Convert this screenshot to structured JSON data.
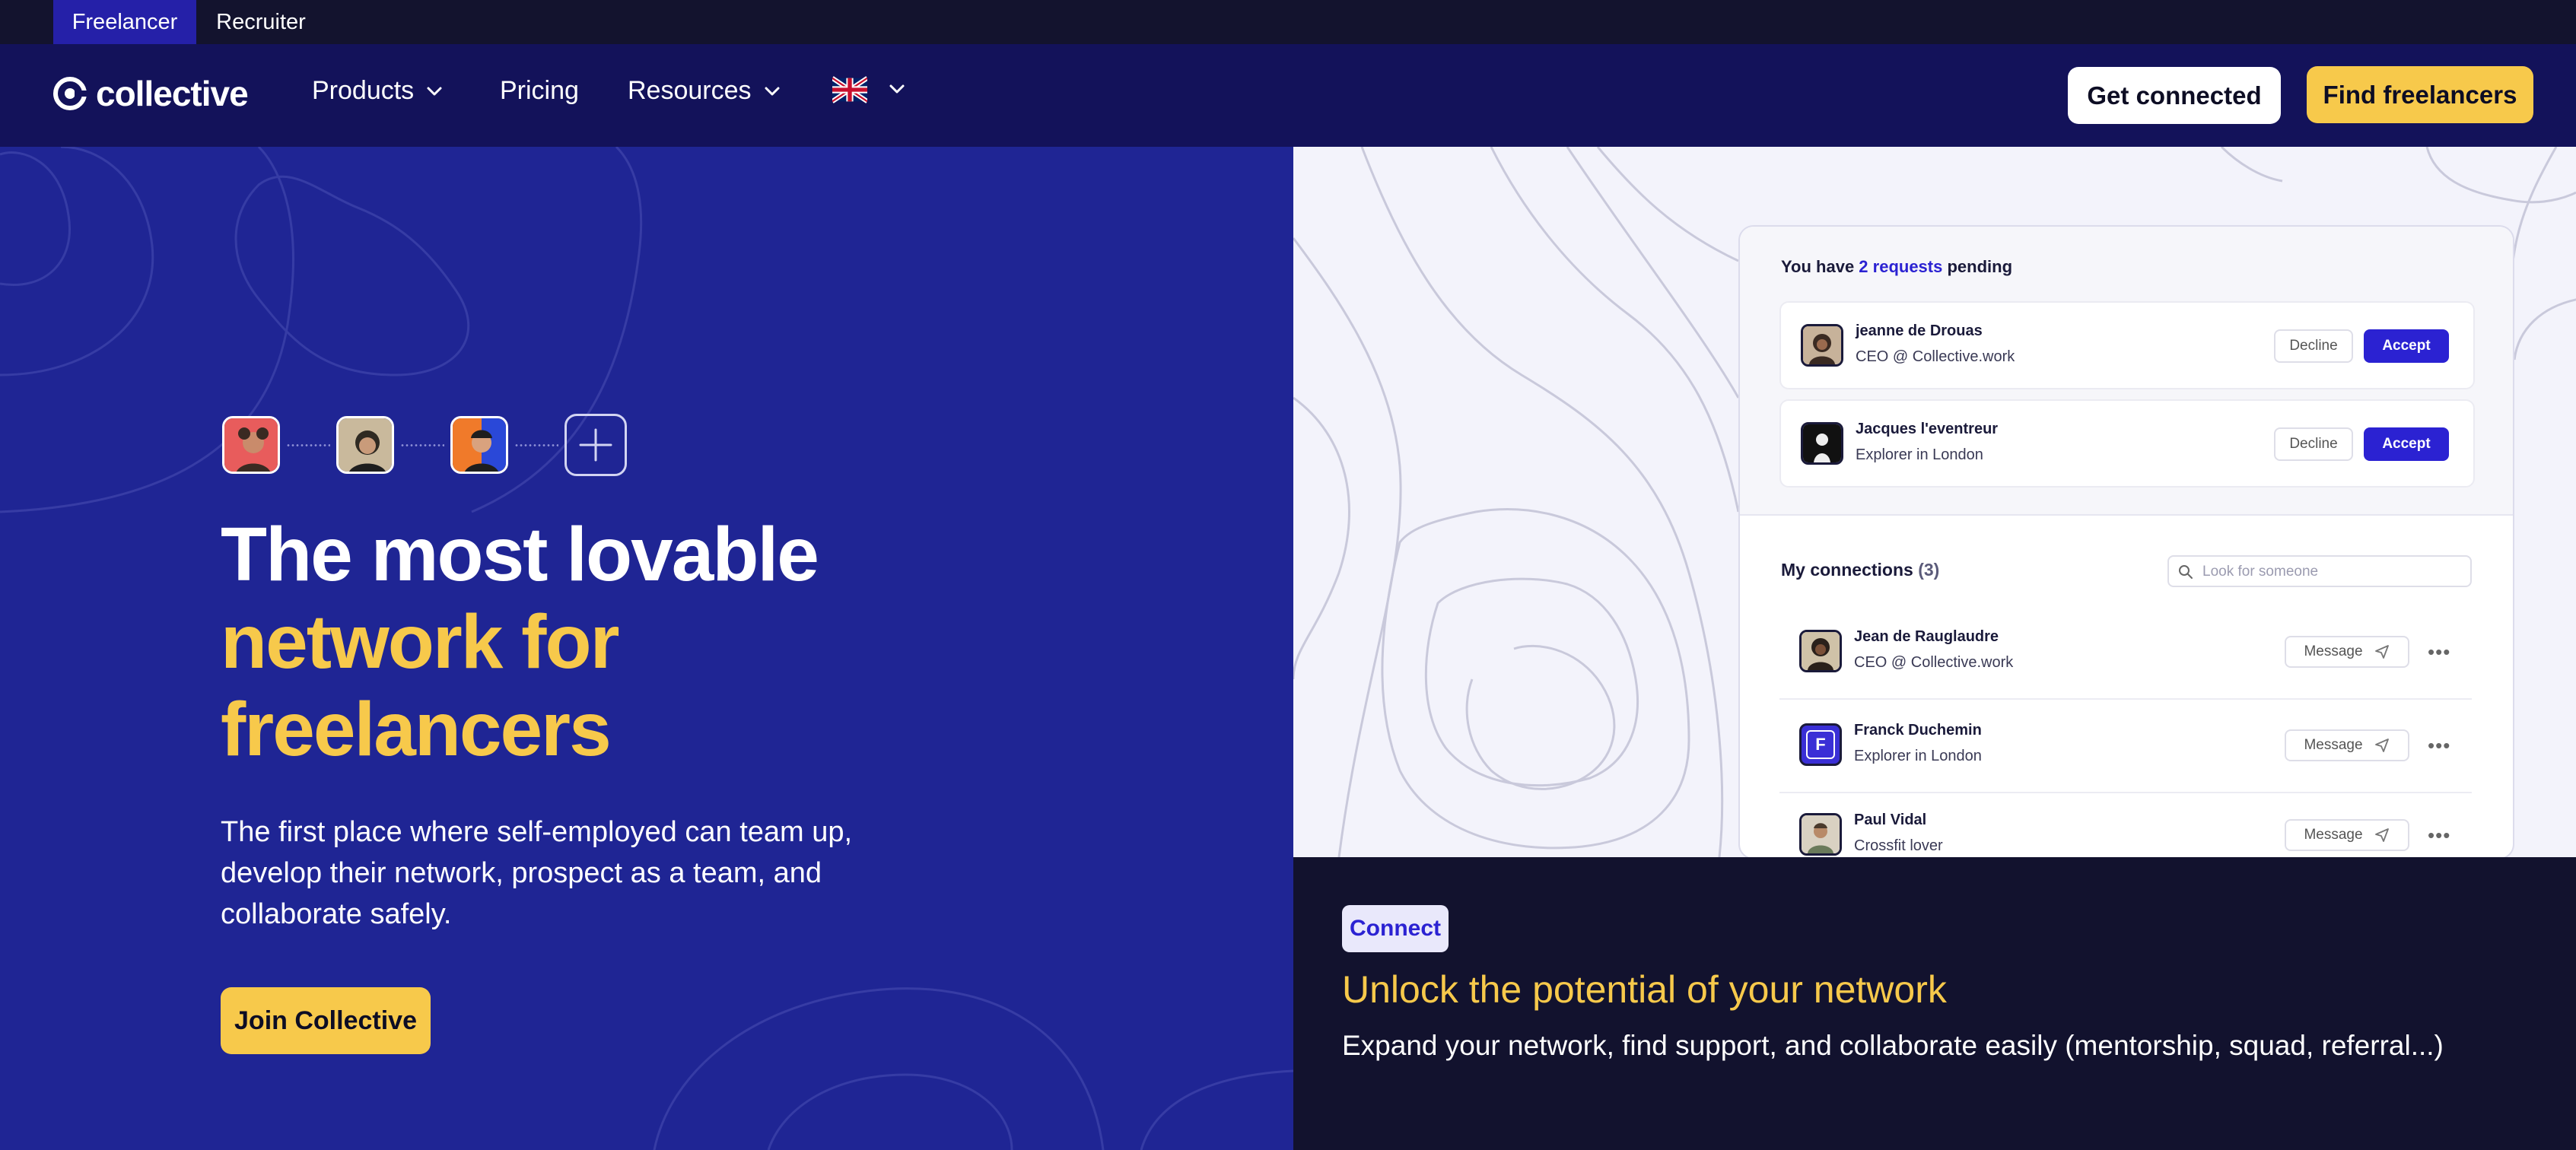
{
  "switcher": {
    "freelancer": "Freelancer",
    "recruiter": "Recruiter"
  },
  "header": {
    "logo": "collective",
    "nav": {
      "products": "Products",
      "pricing": "Pricing",
      "resources": "Resources"
    },
    "language_flag": "uk-flag-icon",
    "get_connected": "Get connected",
    "find_freelancers": "Find freelancers"
  },
  "hero": {
    "headline_line1": "The most lovable",
    "headline_line2": "network for",
    "headline_line3": "freelancers",
    "subtext": "The first place where self-employed can team up, develop their network, prospect as a team, and collaborate safely.",
    "cta": "Join Collective"
  },
  "preview": {
    "pending_prefix": "You have ",
    "pending_link": "2 requests",
    "pending_suffix": " pending",
    "requests": [
      {
        "name": "jeanne de Drouas",
        "subtitle": "CEO @ Collective.work",
        "decline": "Decline",
        "accept": "Accept"
      },
      {
        "name": "Jacques l'eventreur",
        "subtitle": "Explorer in London",
        "decline": "Decline",
        "accept": "Accept"
      }
    ],
    "connections_title": "My connections",
    "connections_count": "(3)",
    "search_placeholder": "Look for someone",
    "connections": [
      {
        "name": "Jean de Rauglaudre",
        "subtitle": "CEO @ Collective.work",
        "message": "Message"
      },
      {
        "name": "Franck Duchemin",
        "subtitle": "Explorer in London",
        "message": "Message",
        "initial": "F"
      },
      {
        "name": "Paul Vidal",
        "subtitle": "Crossfit lover",
        "message": "Message"
      }
    ]
  },
  "feature": {
    "badge": "Connect",
    "title": "Unlock the potential of your network",
    "text": "Expand your network, find support, and collaborate easily (mentorship, squad, referral...)"
  },
  "colors": {
    "navy": "#13125a",
    "hero_blue": "#1f2594",
    "accent_yellow": "#f7c94b",
    "primary_purple": "#2b22d2",
    "dark": "#12122e"
  }
}
